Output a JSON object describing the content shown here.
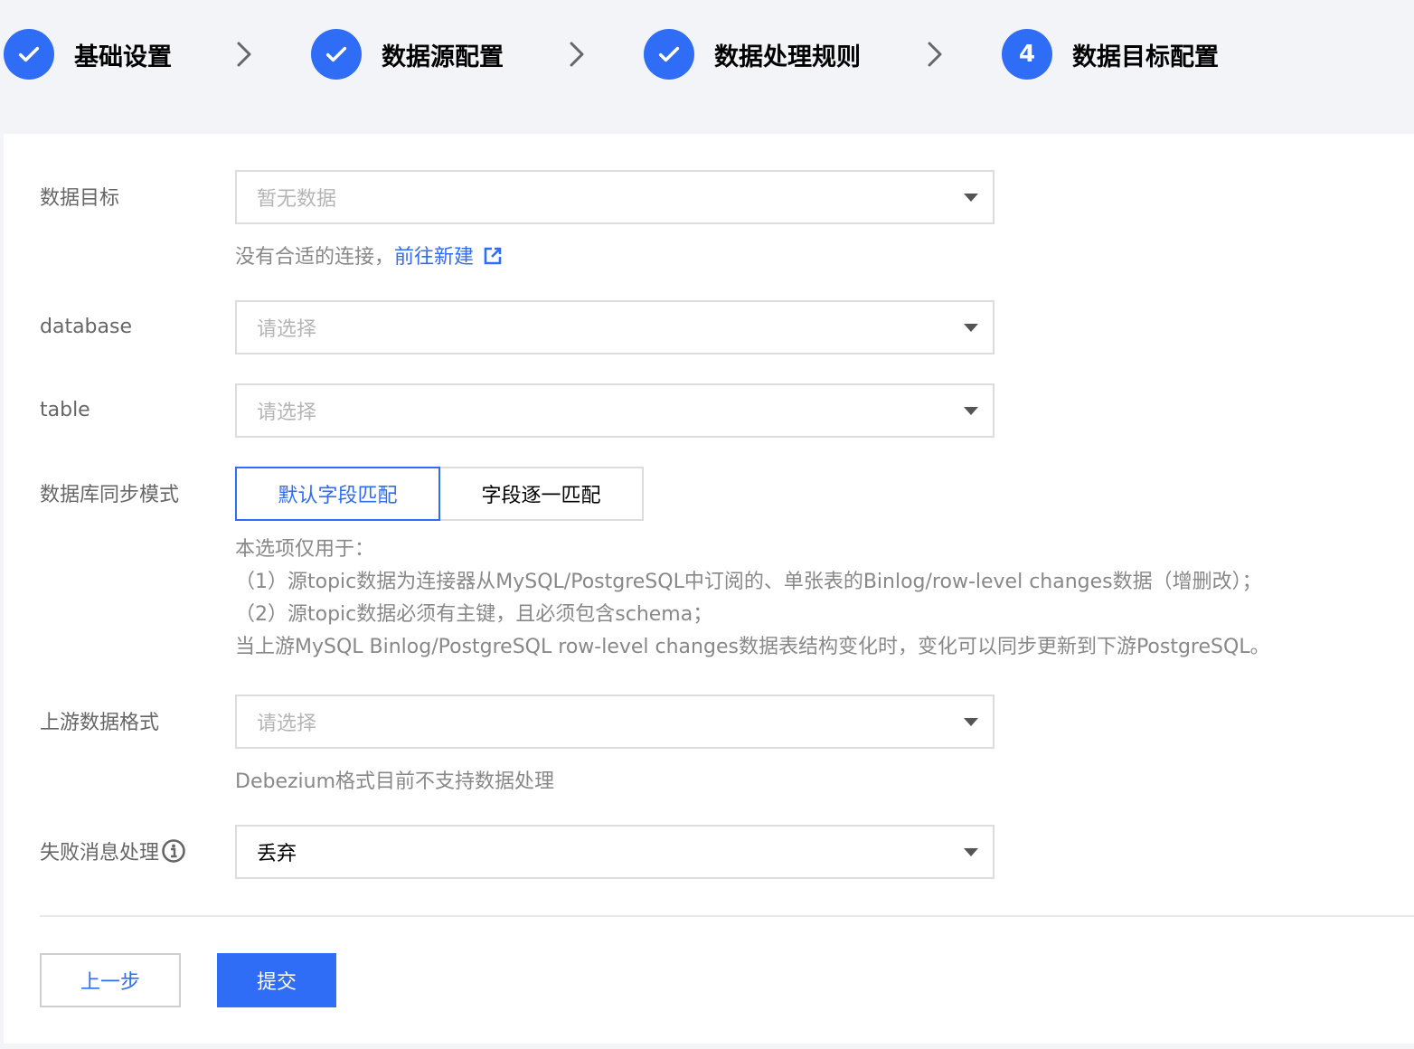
{
  "steps": [
    {
      "label": "基础设置",
      "status": "done"
    },
    {
      "label": "数据源配置",
      "status": "done"
    },
    {
      "label": "数据处理规则",
      "status": "done"
    },
    {
      "label": "数据目标配置",
      "status": "current",
      "number": "4"
    }
  ],
  "form": {
    "target": {
      "label": "数据目标",
      "placeholder": "暂无数据"
    },
    "target_hint": {
      "text": "没有合适的连接，",
      "link": "前往新建"
    },
    "database": {
      "label": "database",
      "placeholder": "请选择"
    },
    "table": {
      "label": "table",
      "placeholder": "请选择"
    },
    "sync_mode": {
      "label": "数据库同步模式",
      "options": [
        "默认字段匹配",
        "字段逐一匹配"
      ],
      "selected": "默认字段匹配"
    },
    "sync_note": [
      "本选项仅用于：",
      "（1）源topic数据为连接器从MySQL/PostgreSQL中订阅的、单张表的Binlog/row-level changes数据（增删改）；",
      "（2）源topic数据必须有主键，且必须包含schema；",
      "当上游MySQL Binlog/PostgreSQL row-level changes数据表结构变化时，变化可以同步更新到下游PostgreSQL。"
    ],
    "upstream_format": {
      "label": "上游数据格式",
      "placeholder": "请选择"
    },
    "upstream_hint": "Debezium格式目前不支持数据处理",
    "failure_handling": {
      "label": "失败消息处理",
      "value": "丢弃"
    }
  },
  "actions": {
    "prev": "上一步",
    "submit": "提交"
  },
  "colors": {
    "primary": "#2f6df6",
    "background": "#f3f4f7"
  }
}
